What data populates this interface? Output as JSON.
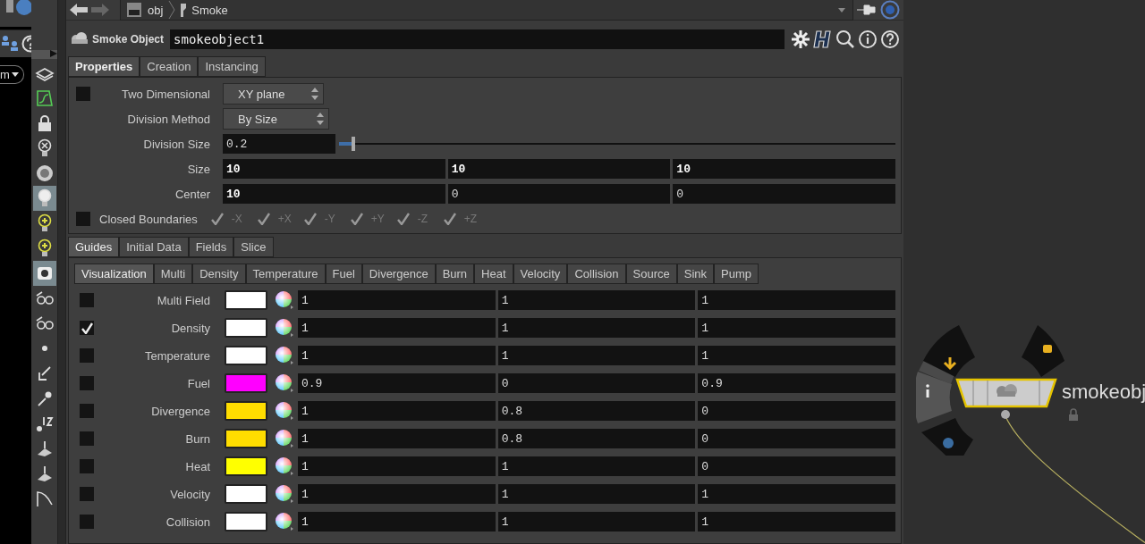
{
  "left_panel": {
    "menu_label": "m"
  },
  "nav": {
    "path": [
      {
        "label": "obj"
      },
      {
        "label": "Smoke"
      }
    ]
  },
  "node_header": {
    "type_label": "Smoke Object",
    "name": "smokeobject1"
  },
  "tabs": [
    {
      "label": "Properties",
      "selected": true
    },
    {
      "label": "Creation",
      "selected": false
    },
    {
      "label": "Instancing",
      "selected": false
    }
  ],
  "properties": {
    "two_dimensional": {
      "label": "Two Dimensional",
      "checked": false,
      "value": "XY plane"
    },
    "division_method": {
      "label": "Division Method",
      "value": "By Size"
    },
    "division_size": {
      "label": "Division Size",
      "value": "0.2",
      "level": 0.025
    },
    "size": {
      "label": "Size",
      "values": [
        {
          "value": "10",
          "modified": true
        },
        {
          "value": "10",
          "modified": true
        },
        {
          "value": "10",
          "modified": true
        }
      ]
    },
    "center": {
      "label": "Center",
      "values": [
        {
          "value": "10",
          "modified": true
        },
        {
          "value": "0",
          "modified": false
        },
        {
          "value": "0",
          "modified": false
        }
      ]
    },
    "closed_boundaries": {
      "label": "Closed Boundaries",
      "checked": false,
      "axes": [
        {
          "label": "-X",
          "checked": true,
          "disabled": true
        },
        {
          "label": "+X",
          "checked": true,
          "disabled": true
        },
        {
          "label": "-Y",
          "checked": true,
          "disabled": true
        },
        {
          "label": "+Y",
          "checked": true,
          "disabled": true
        },
        {
          "label": "-Z",
          "checked": true,
          "disabled": true
        },
        {
          "label": "+Z",
          "checked": true,
          "disabled": true
        }
      ]
    }
  },
  "sub_tabs": [
    {
      "label": "Guides",
      "selected": true
    },
    {
      "label": "Initial Data",
      "selected": false
    },
    {
      "label": "Fields",
      "selected": false
    },
    {
      "label": "Slice",
      "selected": false
    }
  ],
  "guide_tabs": [
    {
      "label": "Visualization",
      "selected": true
    },
    {
      "label": "Multi",
      "selected": false
    },
    {
      "label": "Density",
      "selected": false
    },
    {
      "label": "Temperature",
      "selected": false
    },
    {
      "label": "Fuel",
      "selected": false
    },
    {
      "label": "Divergence",
      "selected": false
    },
    {
      "label": "Burn",
      "selected": false
    },
    {
      "label": "Heat",
      "selected": false
    },
    {
      "label": "Velocity",
      "selected": false
    },
    {
      "label": "Collision",
      "selected": false
    },
    {
      "label": "Source",
      "selected": false
    },
    {
      "label": "Sink",
      "selected": false
    },
    {
      "label": "Pump",
      "selected": false
    }
  ],
  "fields": [
    {
      "label": "Multi Field",
      "visible": false,
      "color": "#ffffff",
      "values": [
        "1",
        "1",
        "1"
      ]
    },
    {
      "label": "Density",
      "visible": true,
      "color": "#ffffff",
      "values": [
        "1",
        "1",
        "1"
      ]
    },
    {
      "label": "Temperature",
      "visible": false,
      "color": "#ffffff",
      "values": [
        "1",
        "1",
        "1"
      ]
    },
    {
      "label": "Fuel",
      "visible": false,
      "color": "#ff00ff",
      "values": [
        "0.9",
        "0",
        "0.9"
      ]
    },
    {
      "label": "Divergence",
      "visible": false,
      "color": "#ffdd00",
      "values": [
        "1",
        "0.8",
        "0"
      ]
    },
    {
      "label": "Burn",
      "visible": false,
      "color": "#ffdd00",
      "values": [
        "1",
        "0.8",
        "0"
      ]
    },
    {
      "label": "Heat",
      "visible": false,
      "color": "#ffff00",
      "values": [
        "1",
        "1",
        "0"
      ]
    },
    {
      "label": "Velocity",
      "visible": false,
      "color": "#ffffff",
      "values": [
        "1",
        "1",
        "1"
      ]
    },
    {
      "label": "Collision",
      "visible": false,
      "color": "#ffffff",
      "values": [
        "1",
        "1",
        "1"
      ]
    }
  ],
  "network": {
    "node_label": "smokeobj"
  }
}
